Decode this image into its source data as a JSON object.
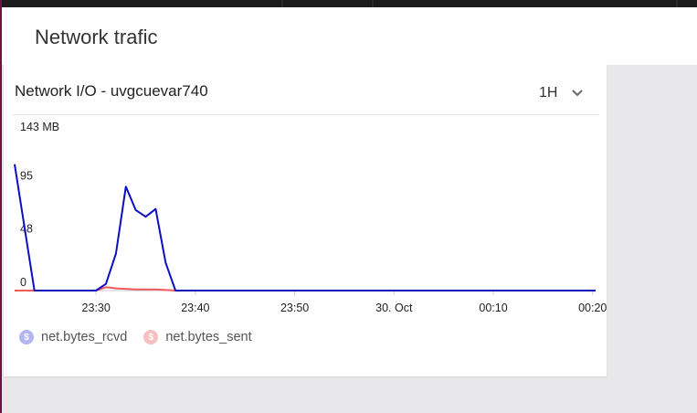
{
  "header": {
    "title": "Network trafic"
  },
  "widget": {
    "title": "Network I/O - uvgcuevar740",
    "time_range": "1H"
  },
  "legend": [
    {
      "label": "net.bytes_rcvd",
      "icon": "dollar-icon",
      "color": "#b3b6f2"
    },
    {
      "label": "net.bytes_sent",
      "icon": "dollar-icon",
      "color": "#f7c0c0"
    }
  ],
  "chart_data": {
    "type": "line",
    "y_unit": "MB",
    "y_ticks": [
      "0",
      "48",
      "95",
      "143 MB"
    ],
    "y_tick_values": [
      0,
      48,
      95,
      143
    ],
    "ylim": [
      0,
      143
    ],
    "x_ticks": [
      "23:30",
      "23:40",
      "23:50",
      "30. Oct",
      "00:10",
      "00:20"
    ],
    "x_tick_values": [
      30,
      40,
      50,
      60,
      70,
      80
    ],
    "xlim": [
      21.8,
      80.3
    ],
    "series": [
      {
        "name": "net.bytes_rcvd",
        "color": "#0b0fbf",
        "points": [
          [
            21.8,
            113
          ],
          [
            23.8,
            0
          ],
          [
            28.0,
            0
          ],
          [
            30.0,
            0
          ],
          [
            31.0,
            6
          ],
          [
            32.0,
            33
          ],
          [
            33.0,
            93
          ],
          [
            34.0,
            72
          ],
          [
            35.0,
            66
          ],
          [
            36.0,
            73
          ],
          [
            37.0,
            25
          ],
          [
            38.0,
            0
          ],
          [
            45.0,
            0
          ],
          [
            60.0,
            0
          ],
          [
            80.3,
            0
          ]
        ]
      },
      {
        "name": "net.bytes_sent",
        "color": "#f05a5a",
        "points": [
          [
            21.8,
            0
          ],
          [
            30.0,
            0
          ],
          [
            31.0,
            3
          ],
          [
            32.0,
            2
          ],
          [
            34.0,
            1
          ],
          [
            36.0,
            1
          ],
          [
            38.0,
            0
          ],
          [
            80.3,
            0
          ]
        ]
      }
    ]
  }
}
